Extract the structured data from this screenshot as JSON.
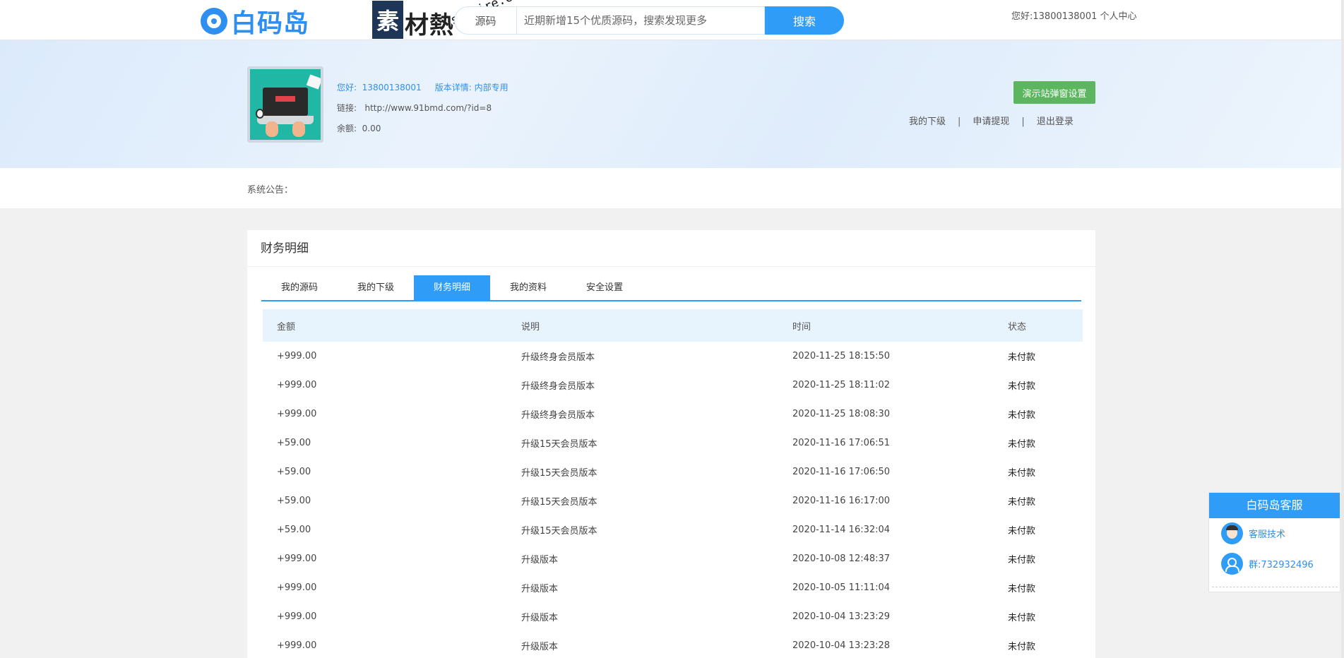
{
  "header": {
    "logo_text": "白码岛",
    "watermark_chars": "素材",
    "watermark_block": "素",
    "watermark_tail": "材熱",
    "watermark_url": "sucaire.com",
    "search_type": "源码",
    "search_placeholder": "近期新增15个优质源码，搜索发现更多",
    "search_button": "搜索",
    "greeting": "您好:13800138001",
    "personal_center": "个人中心"
  },
  "profile": {
    "hello_line": "您好:  13800138001     版本详情: 内部专用",
    "link_label": "链接:   http://www.91bmd.com/?id=8",
    "balance_label": "余额:  0.00",
    "popup_settings_button": "演示站弹窗设置",
    "links": [
      "我的下级",
      "申请提现",
      "退出登录"
    ],
    "separator": "|"
  },
  "notice": {
    "label": "系统公告："
  },
  "panel": {
    "title": "财务明细",
    "tabs": [
      "我的源码",
      "我的下级",
      "财务明细",
      "我的资料",
      "安全设置"
    ],
    "active_tab": "财务明细",
    "columns": [
      "金额",
      "说明",
      "时间",
      "状态"
    ],
    "rows": [
      {
        "amount": "+999.00",
        "desc": "升级终身会员版本",
        "time": "2020-11-25 18:15:50",
        "status": "未付款"
      },
      {
        "amount": "+999.00",
        "desc": "升级终身会员版本",
        "time": "2020-11-25 18:11:02",
        "status": "未付款"
      },
      {
        "amount": "+999.00",
        "desc": "升级终身会员版本",
        "time": "2020-11-25 18:08:30",
        "status": "未付款"
      },
      {
        "amount": "+59.00",
        "desc": "升级15天会员版本",
        "time": "2020-11-16 17:06:51",
        "status": "未付款"
      },
      {
        "amount": "+59.00",
        "desc": "升级15天会员版本",
        "time": "2020-11-16 17:06:50",
        "status": "未付款"
      },
      {
        "amount": "+59.00",
        "desc": "升级15天会员版本",
        "time": "2020-11-16 16:17:00",
        "status": "未付款"
      },
      {
        "amount": "+59.00",
        "desc": "升级15天会员版本",
        "time": "2020-11-14 16:32:04",
        "status": "未付款"
      },
      {
        "amount": "+999.00",
        "desc": "升级版本",
        "time": "2020-10-08 12:48:37",
        "status": "未付款"
      },
      {
        "amount": "+999.00",
        "desc": "升级版本",
        "time": "2020-10-05 11:11:04",
        "status": "未付款"
      },
      {
        "amount": "+999.00",
        "desc": "升级版本",
        "time": "2020-10-04 13:23:29",
        "status": "未付款"
      },
      {
        "amount": "+999.00",
        "desc": "升级版本",
        "time": "2020-10-04 13:23:28",
        "status": "未付款"
      }
    ]
  },
  "customer_service": {
    "title": "白码岛客服",
    "tech_label": "客服技术",
    "group_label": "群:732932496"
  },
  "colors": {
    "primary": "#2f9df8",
    "green_button": "#5bb65f",
    "table_header_bg": "#e8f4fd"
  }
}
